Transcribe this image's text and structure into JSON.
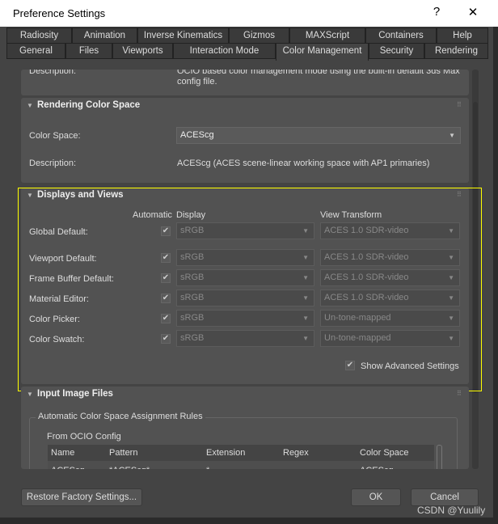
{
  "window": {
    "title": "Preference Settings",
    "help": "?",
    "close": "✕"
  },
  "tabs_row1": [
    "Radiosity",
    "Animation",
    "Inverse Kinematics",
    "Gizmos",
    "MAXScript",
    "Containers",
    "Help"
  ],
  "tabs_row2": [
    "General",
    "Files",
    "Viewports",
    "Interaction Mode",
    "Color Management",
    "Security",
    "Rendering"
  ],
  "active_tab": "Color Management",
  "mode_panel": {
    "label": "Description:",
    "text1": "OCIO based color management mode using the built-in default 3ds Max",
    "text2": "config file."
  },
  "rendering": {
    "title": "Rendering Color Space",
    "color_space_label": "Color Space:",
    "color_space": "ACEScg",
    "desc_label": "Description:",
    "description": "ACEScg (ACES scene-linear working space with AP1 primaries)"
  },
  "displays": {
    "title": "Displays and Views",
    "col_automatic": "Automatic",
    "col_display": "Display",
    "col_view": "View Transform",
    "rows": [
      {
        "label": "Global Default:",
        "auto": true,
        "display": "sRGB",
        "view": "ACES 1.0 SDR-video"
      },
      {
        "label": "Viewport Default:",
        "auto": true,
        "display": "sRGB",
        "view": "ACES 1.0 SDR-video"
      },
      {
        "label": "Frame Buffer Default:",
        "auto": true,
        "display": "sRGB",
        "view": "ACES 1.0 SDR-video"
      },
      {
        "label": "Material Editor:",
        "auto": true,
        "display": "sRGB",
        "view": "ACES 1.0 SDR-video"
      },
      {
        "label": "Color Picker:",
        "auto": true,
        "display": "sRGB",
        "view": "Un-tone-mapped"
      },
      {
        "label": "Color Swatch:",
        "auto": true,
        "display": "sRGB",
        "view": "Un-tone-mapped"
      }
    ],
    "show_advanced": "Show Advanced Settings",
    "show_advanced_checked": true
  },
  "input": {
    "title": "Input Image Files",
    "group": "Automatic Color Space Assignment Rules",
    "subtitle": "From OCIO Config",
    "columns": [
      "Name",
      "Pattern",
      "Extension",
      "Regex",
      "Color Space"
    ],
    "rows": [
      [
        "ACEScg",
        "*ACEScg*",
        "*",
        "",
        "ACEScg"
      ]
    ]
  },
  "buttons": {
    "restore": "Restore Factory Settings...",
    "ok": "OK",
    "cancel": "Cancel"
  },
  "watermark": "CSDN @Yuulily",
  "colors": {
    "highlight": "#ffff00",
    "background": "#444444"
  }
}
